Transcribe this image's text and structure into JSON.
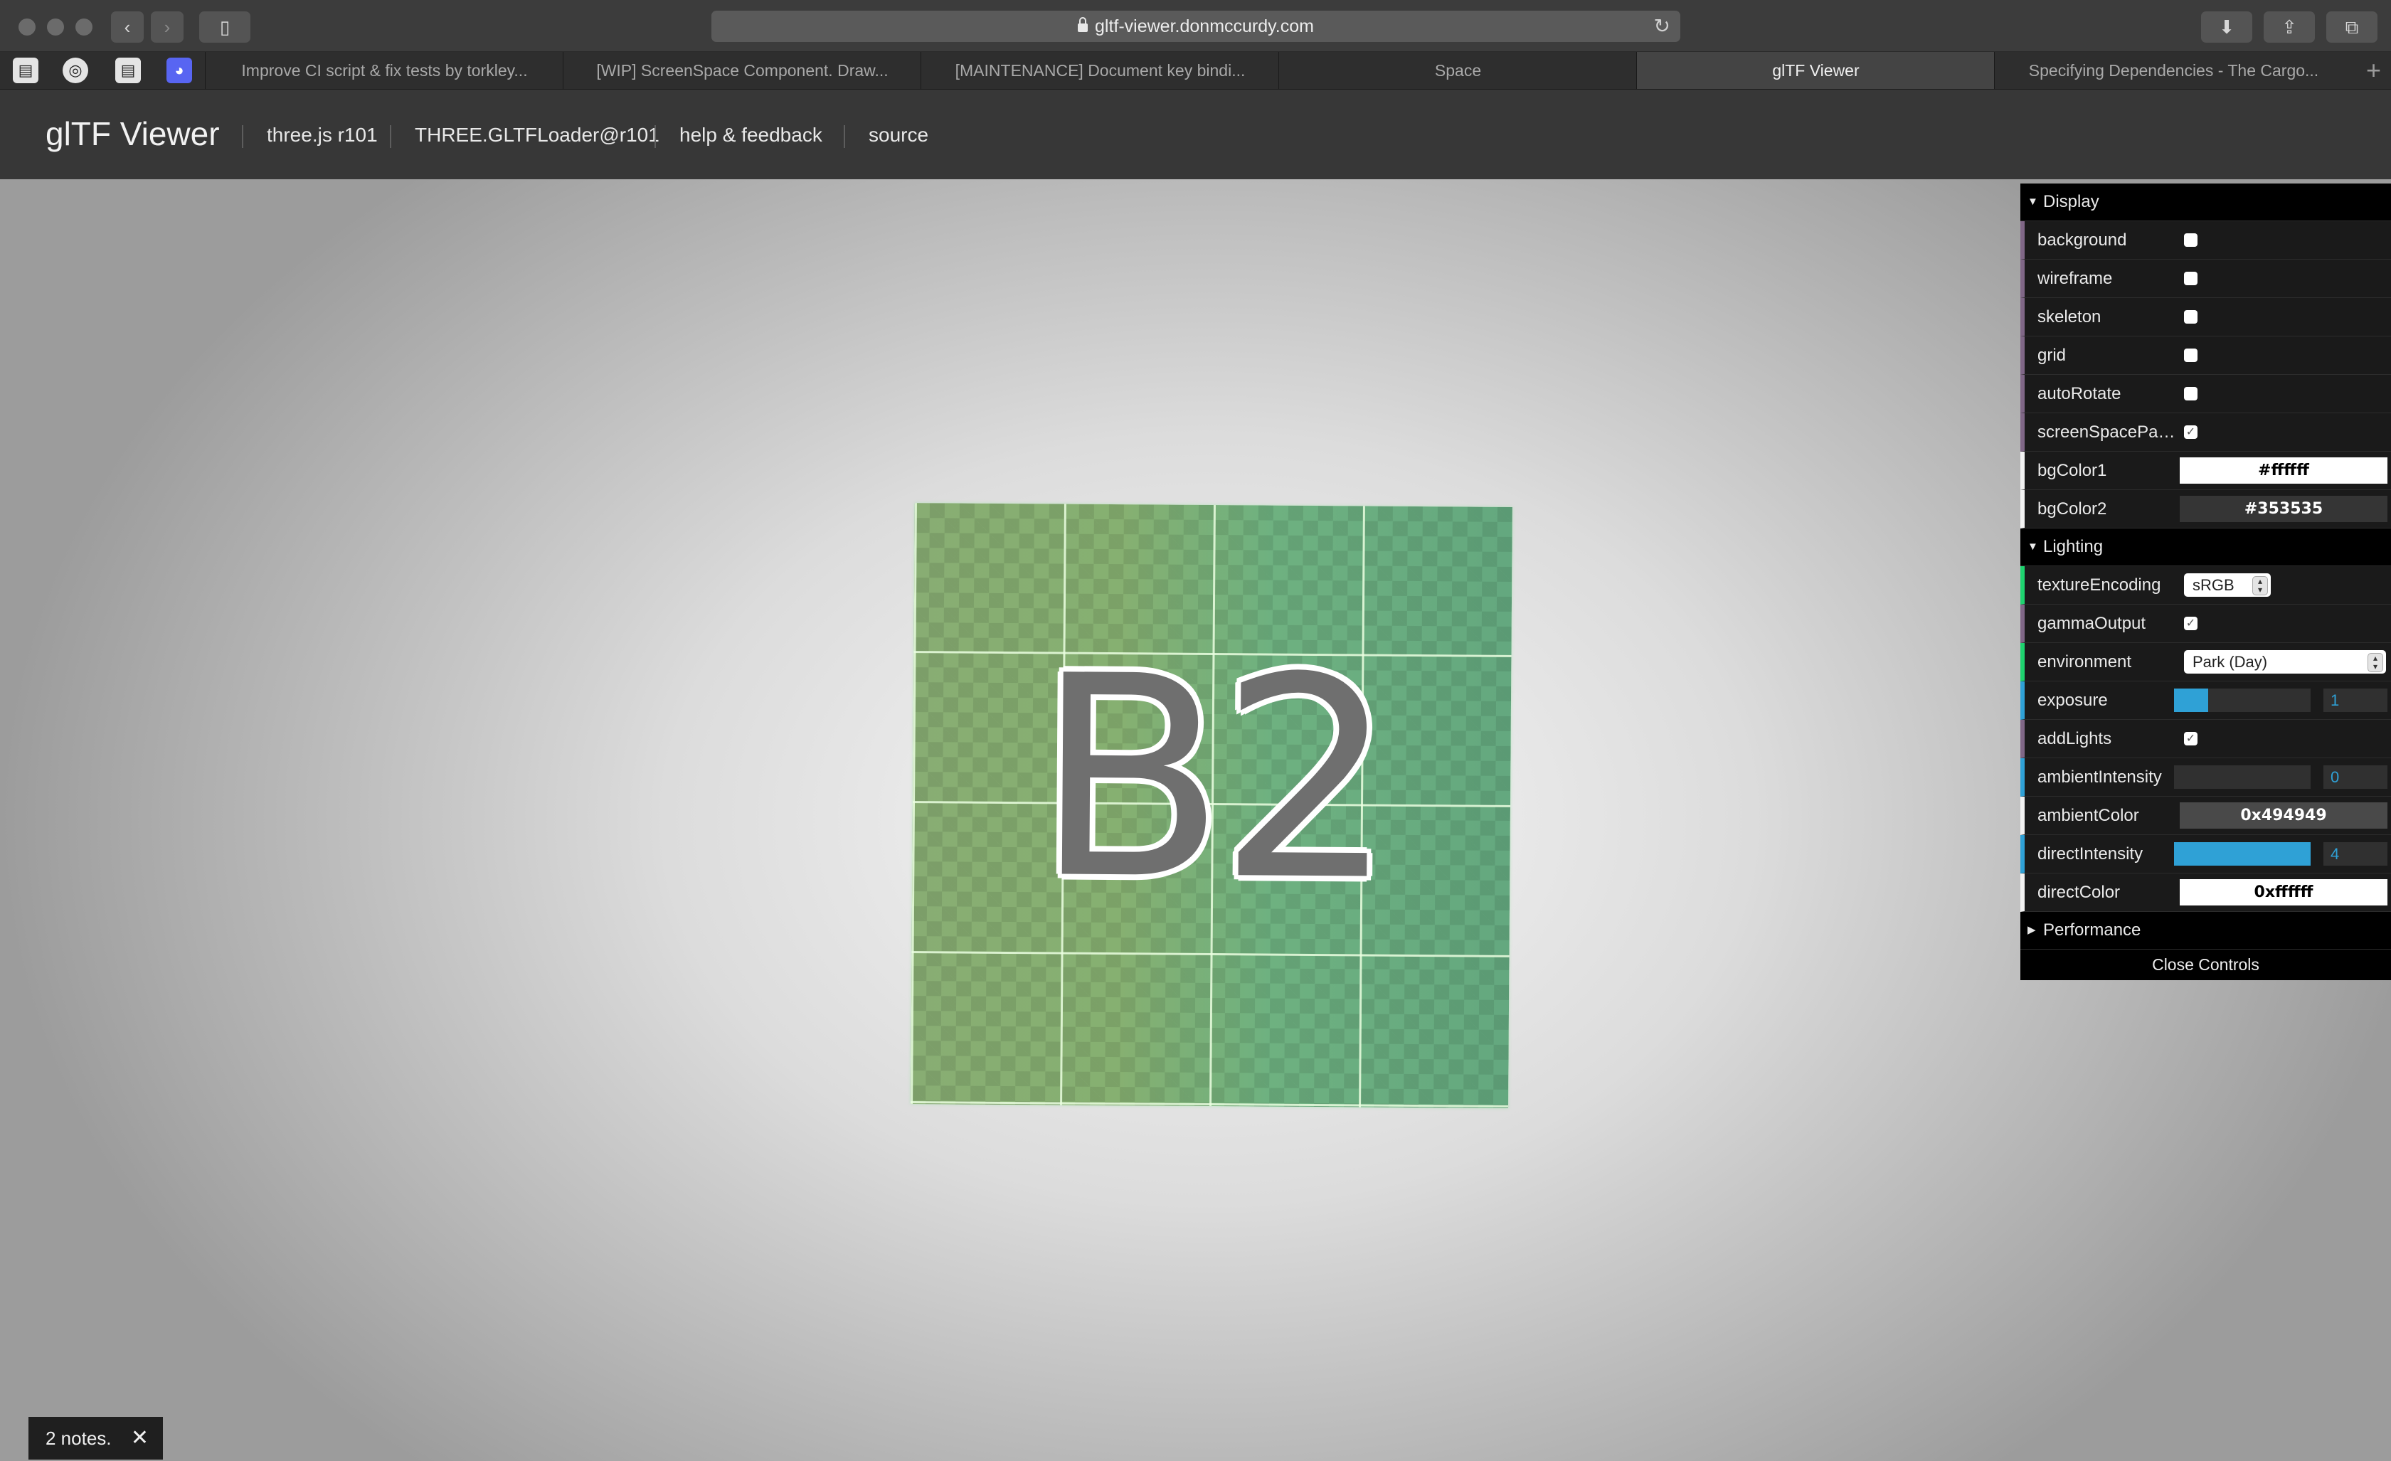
{
  "browser": {
    "url": "gltf-viewer.donmccurdy.com",
    "tabs": [
      "Improve CI script & fix tests by torkley...",
      "[WIP] ScreenSpace Component. Draw...",
      "[MAINTENANCE] Document key bindi...",
      "Space",
      "glTF Viewer",
      "Specifying Dependencies - The Cargo..."
    ],
    "active_tab_index": 4,
    "new_tab_label": "+"
  },
  "header": {
    "brand": "glTF Viewer",
    "links": [
      "three.js r101",
      "THREE.GLTFLoader@r101",
      "help & feedback",
      "source"
    ]
  },
  "viewport": {
    "model_label": "B2"
  },
  "controls": {
    "display": {
      "title": "Display",
      "background": {
        "label": "background",
        "checked": false
      },
      "wireframe": {
        "label": "wireframe",
        "checked": false
      },
      "skeleton": {
        "label": "skeleton",
        "checked": false
      },
      "grid": {
        "label": "grid",
        "checked": false
      },
      "autoRotate": {
        "label": "autoRotate",
        "checked": false
      },
      "screenSpacePanning": {
        "label": "screenSpacePan...",
        "checked": true
      },
      "bgColor1": {
        "label": "bgColor1",
        "value": "#ffffff"
      },
      "bgColor2": {
        "label": "bgColor2",
        "value": "#353535"
      }
    },
    "lighting": {
      "title": "Lighting",
      "textureEncoding": {
        "label": "textureEncoding",
        "value": "sRGB"
      },
      "gammaOutput": {
        "label": "gammaOutput",
        "checked": true
      },
      "environment": {
        "label": "environment",
        "value": "Park (Day)"
      },
      "exposure": {
        "label": "exposure",
        "value": "1",
        "fraction": 0.25
      },
      "addLights": {
        "label": "addLights",
        "checked": true
      },
      "ambientIntensity": {
        "label": "ambientIntensity",
        "value": "0",
        "fraction": 0.0
      },
      "ambientColor": {
        "label": "ambientColor",
        "value": "0x494949"
      },
      "directIntensity": {
        "label": "directIntensity",
        "value": "4",
        "fraction": 1.0
      },
      "directColor": {
        "label": "directColor",
        "value": "0xffffff"
      }
    },
    "performance": {
      "title": "Performance"
    },
    "close_label": "Close Controls"
  },
  "notes": {
    "text": "2 notes.",
    "close": "✕"
  },
  "colors": {
    "accent_number": "#2fa1d6",
    "accent_option": "#1ed36f",
    "accent_bool": "#806787",
    "bgColor1": "#ffffff",
    "bgColor2": "#353535",
    "ambientColor": "#494949",
    "directColor": "#ffffff"
  }
}
